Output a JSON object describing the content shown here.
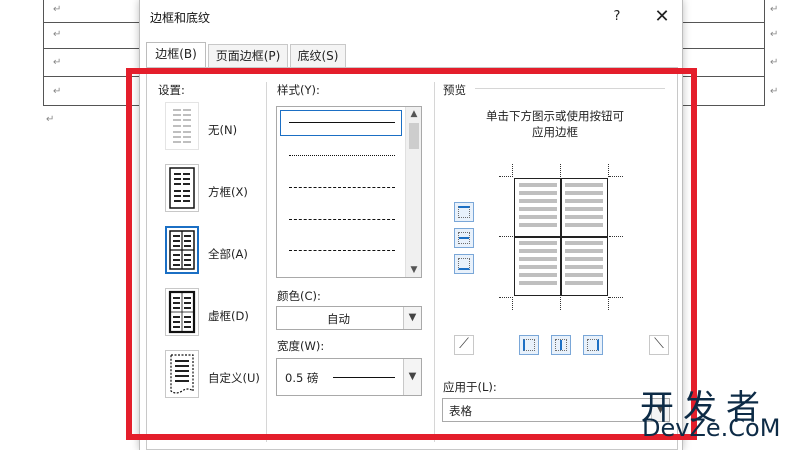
{
  "document": {
    "paragraph_mark": "↵"
  },
  "dialog": {
    "title": "边框和底纹",
    "help": "?",
    "close": "✕",
    "tabs": [
      {
        "label": "边框(B)"
      },
      {
        "label": "页面边框(P)"
      },
      {
        "label": "底纹(S)"
      }
    ],
    "settings": {
      "label": "设置:",
      "items": [
        {
          "label": "无(N)"
        },
        {
          "label": "方框(X)"
        },
        {
          "label": "全部(A)"
        },
        {
          "label": "虚框(D)"
        },
        {
          "label": "自定义(U)"
        }
      ],
      "selected": "全部(A)"
    },
    "style": {
      "label": "样式(Y):"
    },
    "color": {
      "label": "颜色(C):",
      "value": "自动"
    },
    "width": {
      "label": "宽度(W):",
      "value": "0.5 磅"
    },
    "preview": {
      "label": "预览",
      "hint_line1": "单击下方图示或使用按钮可",
      "hint_line2": "应用边框"
    },
    "apply_to": {
      "label": "应用于(L):",
      "value": "表格"
    }
  },
  "highlight_color": "#e41e2b",
  "accent_color": "#1b6fc4",
  "watermark": {
    "line1": "开发者",
    "line2": "DevZe.CoM"
  }
}
